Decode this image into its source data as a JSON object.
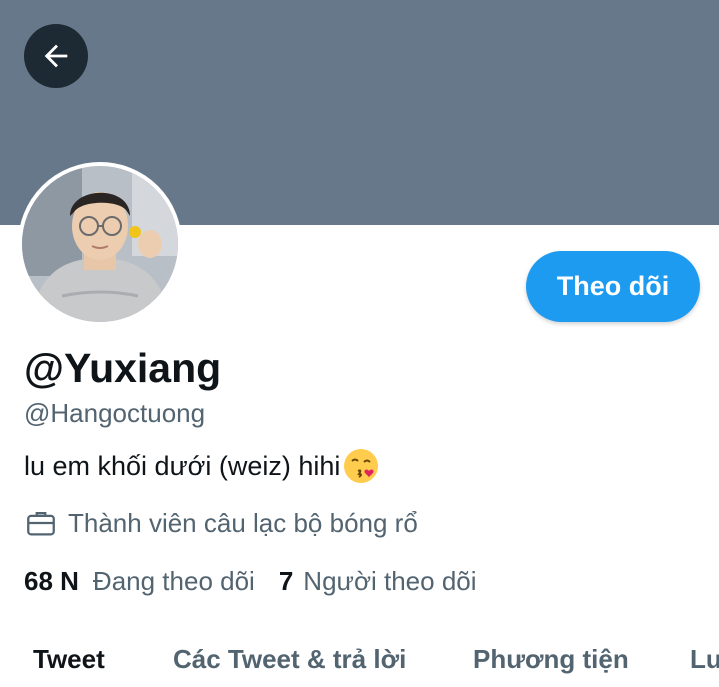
{
  "header": {
    "back_icon": "arrow-left-icon",
    "banner_color": "#66788a"
  },
  "profile": {
    "display_name": "@Yuxiang",
    "handle": "@Hangoctuong",
    "bio_text": "lu em khối dưới (weiz) hihi",
    "bio_emoji": "face-blowing-kiss-emoji",
    "work_icon": "briefcase-icon",
    "work_text": "Thành viên câu lạc bộ bóng rổ",
    "follow_label": "Theo dõi",
    "accent_color": "#1d9bf0"
  },
  "stats": {
    "following_count": "68 N",
    "following_label": "Đang theo dõi",
    "followers_count": "7",
    "followers_label": "Người theo dõi"
  },
  "tabs": [
    {
      "label": "Tweet",
      "active": true
    },
    {
      "label": "Các Tweet & trả lời",
      "active": false
    },
    {
      "label": "Phương tiện",
      "active": false
    },
    {
      "label": "Lu",
      "active": false
    }
  ]
}
